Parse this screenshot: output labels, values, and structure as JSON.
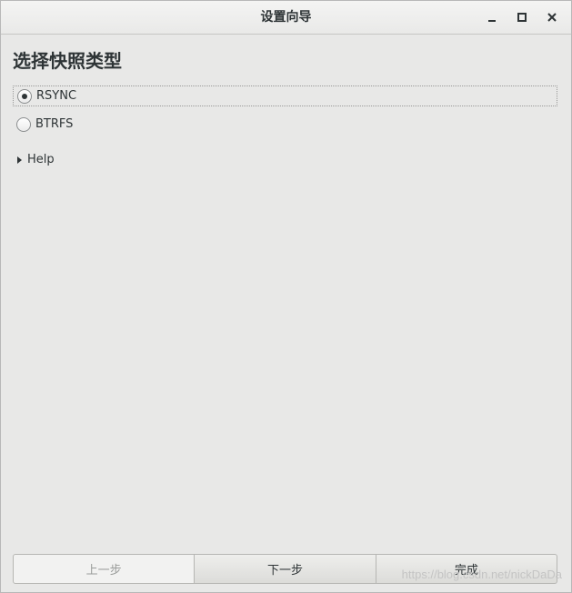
{
  "window": {
    "title": "设置向导",
    "controls": {
      "minimize": "minimize-icon",
      "maximize": "maximize-icon",
      "close": "close-icon"
    }
  },
  "page": {
    "heading": "选择快照类型"
  },
  "snapshot_types": [
    {
      "label": "RSYNC",
      "checked": true
    },
    {
      "label": "BTRFS",
      "checked": false
    }
  ],
  "help": {
    "label": "Help",
    "expanded": false
  },
  "buttons": {
    "back": "上一步",
    "next": "下一步",
    "finish": "完成"
  },
  "watermark": "https://blog.csdn.net/nickDaDa",
  "colors": {
    "text": "#2e3436",
    "background": "#e8e8e7",
    "disabled_text": "#9a9c9a"
  }
}
